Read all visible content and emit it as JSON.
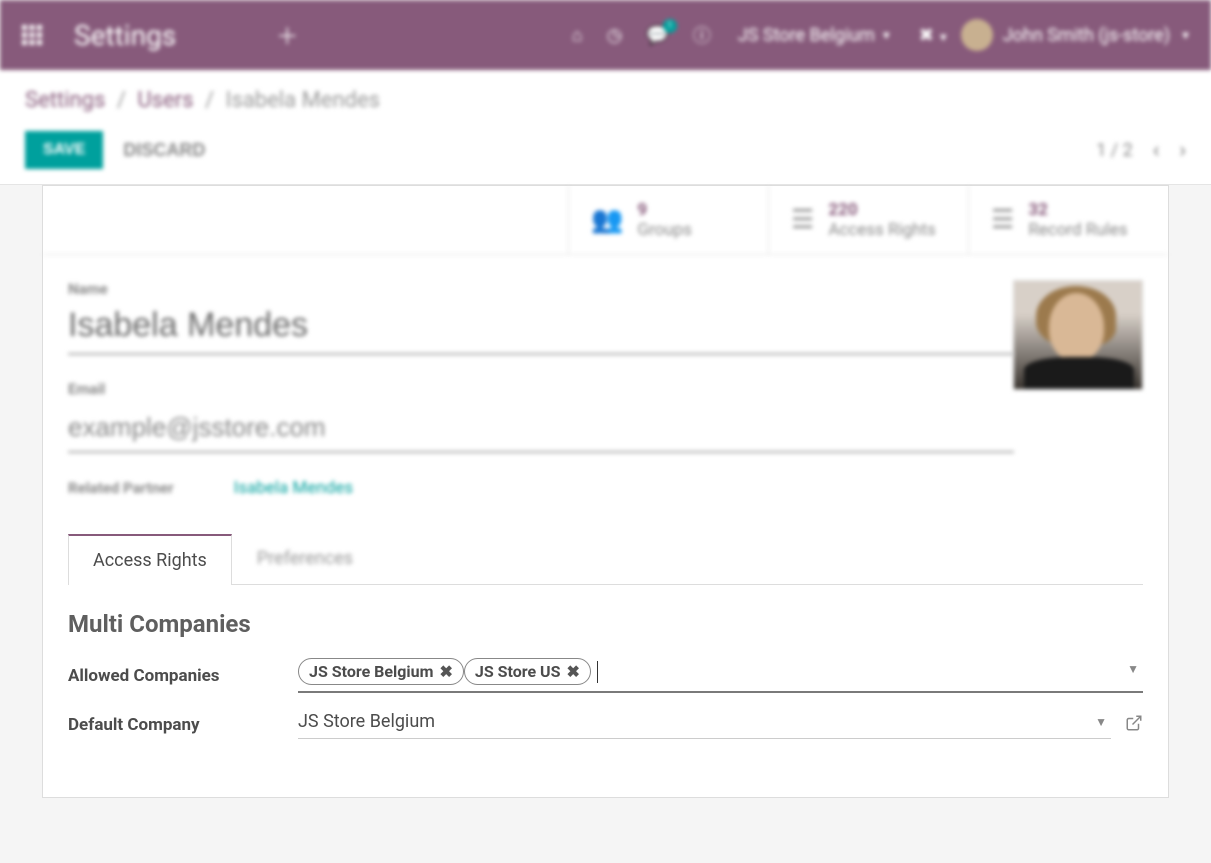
{
  "topbar": {
    "title": "Settings",
    "msg_badge": "1",
    "company": "JS Store Belgium",
    "user": "John Smith (js-store)"
  },
  "breadcrumb": {
    "l1": "Settings",
    "l2": "Users",
    "l3": "Isabela Mendes"
  },
  "actions": {
    "save": "SAVE",
    "discard": "DISCARD",
    "pager": "1 / 2"
  },
  "stats": {
    "groups_count": "9",
    "groups_label": "Groups",
    "access_count": "220",
    "access_label": "Access Rights",
    "rules_count": "32",
    "rules_label": "Record Rules"
  },
  "form": {
    "name_label": "Name",
    "name_value": "Isabela Mendes",
    "email_label": "Email",
    "email_value": "example@jsstore.com",
    "related_label": "Related Partner",
    "related_value": "Isabela Mendes"
  },
  "tabs": {
    "access": "Access Rights",
    "prefs": "Preferences"
  },
  "multi": {
    "section": "Multi Companies",
    "allowed_label": "Allowed Companies",
    "tags": [
      "JS Store Belgium",
      "JS Store US"
    ],
    "default_label": "Default Company",
    "default_value": "JS Store Belgium"
  }
}
